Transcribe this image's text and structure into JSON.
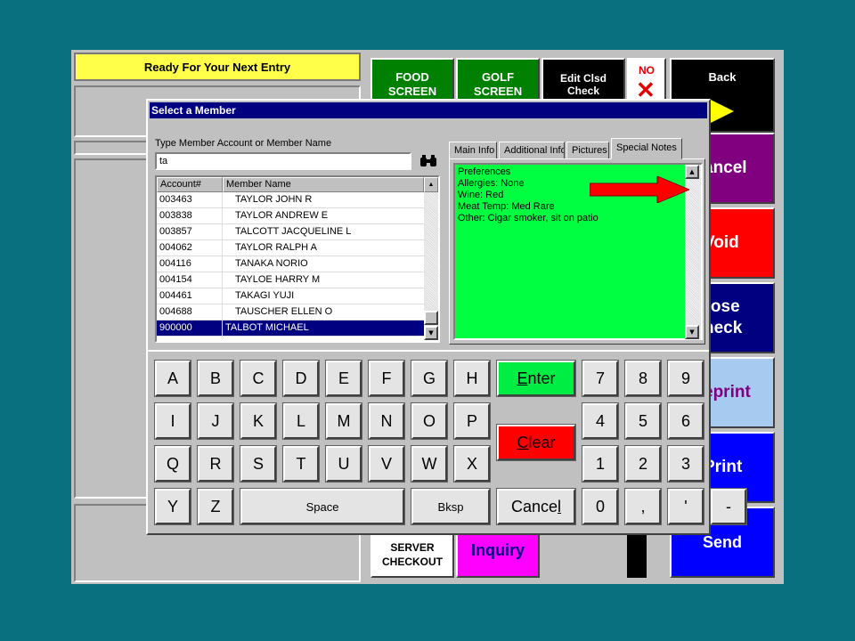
{
  "status_text": "Ready For Your Next Entry",
  "tiles": {
    "food": "FOOD\nSCREEN",
    "golf": "GOLF\nSCREEN",
    "edit_closed": "Edit Clsd\nCheck",
    "no": "NO",
    "back": "Back",
    "cancel": "ancel",
    "void": "Void",
    "close_check": "lose\nheck",
    "reprint": "eprint",
    "print": "Print",
    "send": "Send",
    "server_checkout": "SERVER\nCHECKOUT",
    "inquiry": "Inquiry"
  },
  "dialog": {
    "title": "Select a Member",
    "search_label": "Type Member Account or Member Name",
    "search_value": "ta",
    "columns": {
      "account": "Account#",
      "name": "Member Name"
    },
    "rows": [
      {
        "account": "003463",
        "name": "TAYLOR JOHN R"
      },
      {
        "account": "003838",
        "name": "TAYLOR ANDREW E"
      },
      {
        "account": "003857",
        "name": "TALCOTT JACQUELINE L"
      },
      {
        "account": "004062",
        "name": "TAYLOR RALPH A"
      },
      {
        "account": "004116",
        "name": "TANAKA NORIO"
      },
      {
        "account": "004154",
        "name": "TAYLOE HARRY M"
      },
      {
        "account": "004461",
        "name": "TAKAGI YUJI"
      },
      {
        "account": "004688",
        "name": "TAUSCHER ELLEN O"
      },
      {
        "account": "900000",
        "name": "TALBOT MICHAEL"
      }
    ],
    "selected_row": 8,
    "tabs": [
      "Main Info",
      "Additional Info",
      "Pictures",
      "Special Notes"
    ],
    "active_tab": "Special Notes",
    "notes": [
      "Preferences",
      "Allergies: None",
      "Wine: Red",
      "Meat Temp: Med Rare",
      "Other: Cigar smoker, sit on patio"
    ]
  },
  "keypad": {
    "letters": [
      "A",
      "B",
      "C",
      "D",
      "E",
      "F",
      "G",
      "H",
      "I",
      "J",
      "K",
      "L",
      "M",
      "N",
      "O",
      "P",
      "Q",
      "R",
      "S",
      "T",
      "U",
      "V",
      "W",
      "X",
      "Y",
      "Z"
    ],
    "space": "Space",
    "backspace": "Bksp",
    "enter": "Enter",
    "clear": "Clear",
    "cancel": "Cancel",
    "digits": [
      "7",
      "8",
      "9",
      "4",
      "5",
      "6",
      "1",
      "2",
      "3",
      "0"
    ],
    "comma": ",",
    "apostrophe": "'",
    "dash": "-"
  },
  "colors": {
    "background": "#08707e",
    "status_bg": "#ffff4a",
    "notes_bg": "#00ff41",
    "title_bar": "#000080",
    "enter": "#00ee44",
    "clear": "#ff0000",
    "arrow": "#ff0000"
  }
}
